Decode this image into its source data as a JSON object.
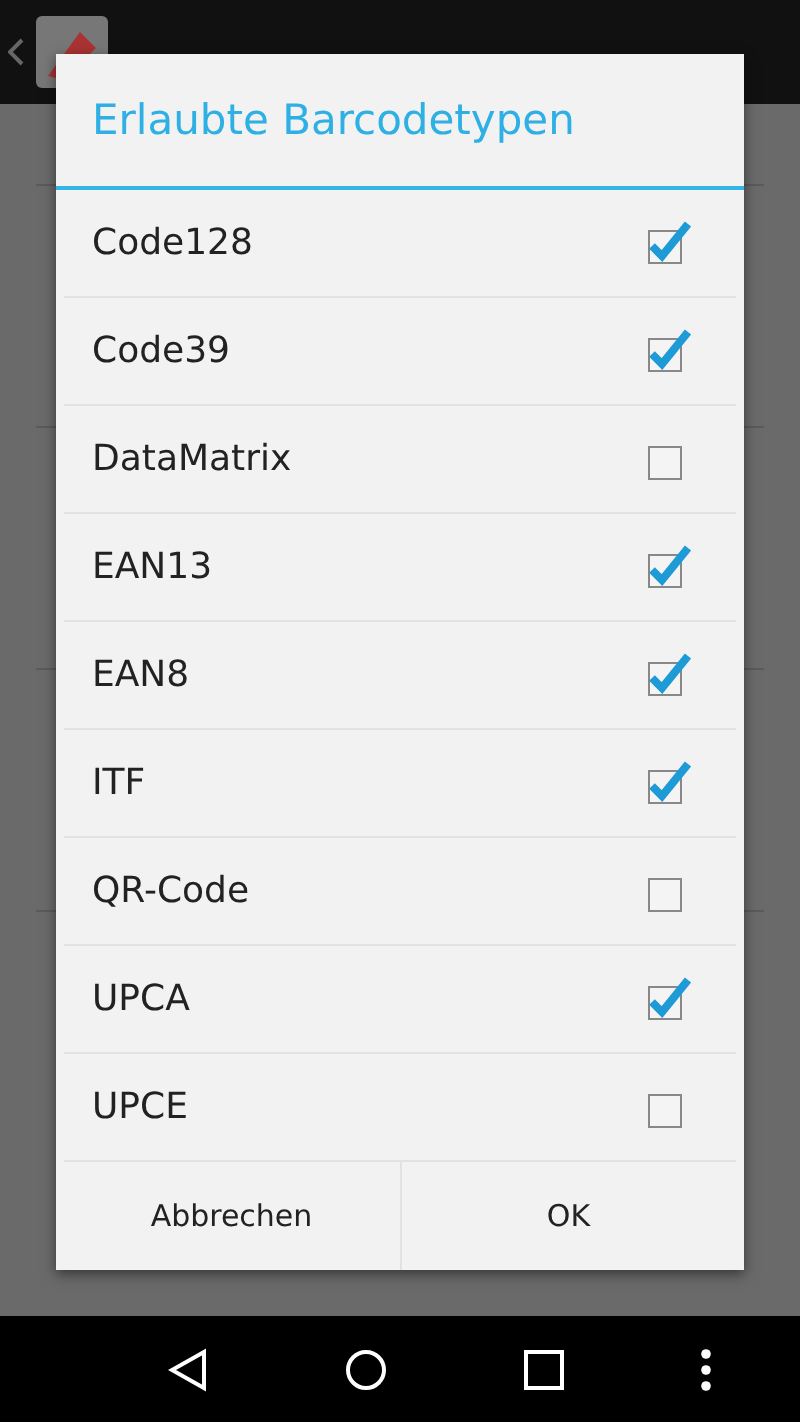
{
  "dialog": {
    "title": "Erlaubte Barcodetypen",
    "options": [
      {
        "label": "Code128",
        "checked": true
      },
      {
        "label": "Code39",
        "checked": true
      },
      {
        "label": "DataMatrix",
        "checked": false
      },
      {
        "label": "EAN13",
        "checked": true
      },
      {
        "label": "EAN8",
        "checked": true
      },
      {
        "label": "ITF",
        "checked": true
      },
      {
        "label": "QR-Code",
        "checked": false
      },
      {
        "label": "UPCA",
        "checked": true
      },
      {
        "label": "UPCE",
        "checked": false
      }
    ],
    "buttons": [
      "Abbrechen",
      "OK"
    ]
  }
}
